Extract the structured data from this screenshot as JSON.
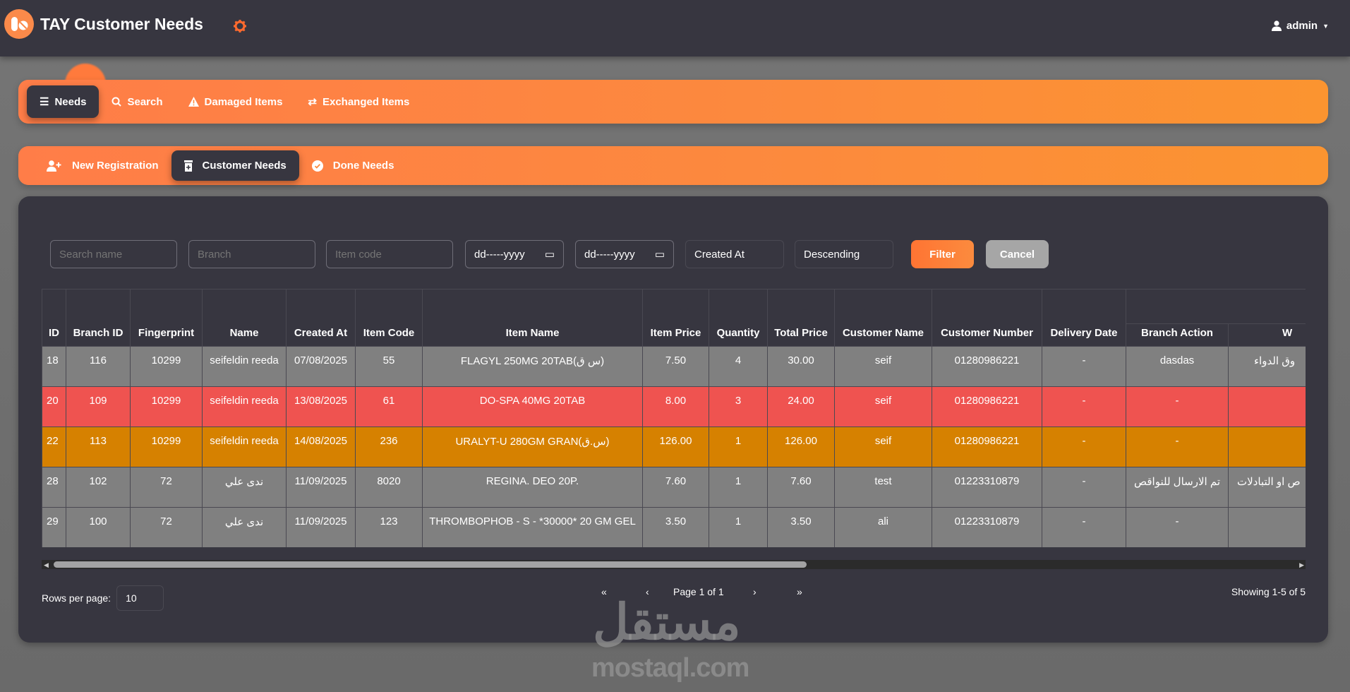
{
  "header": {
    "title": "TAY Customer Needs",
    "user": "admin",
    "icons": {
      "logo": "pills-icon",
      "settings": "gear-icon",
      "user": "user-icon",
      "caret": "caret-down-icon"
    },
    "accent": "#ff7d48"
  },
  "main_nav": [
    {
      "label": "Needs",
      "icon": "list-check-icon",
      "active": true
    },
    {
      "label": "Search",
      "icon": "search-icon",
      "active": false
    },
    {
      "label": "Damaged Items",
      "icon": "warning-icon",
      "active": false
    },
    {
      "label": "Exchanged Items",
      "icon": "exchange-icon",
      "active": false
    }
  ],
  "sub_nav": [
    {
      "label": "New Registration",
      "icon": "user-plus-icon",
      "active": false
    },
    {
      "label": "Customer Needs",
      "icon": "prescription-bottle-icon",
      "active": true
    },
    {
      "label": "Done Needs",
      "icon": "check-circle-icon",
      "active": false
    }
  ],
  "filters": {
    "search_name_placeholder": "Search name",
    "branch_placeholder": "Branch",
    "item_code_placeholder": "Item code",
    "date_from": "dd-----yyyy",
    "date_to": "dd-----yyyy",
    "sort_by": "Created At",
    "sort_order": "Descending",
    "filter_label": "Filter",
    "cancel_label": "Cancel"
  },
  "table": {
    "columns": [
      "ID",
      "Branch ID",
      "Fingerprint",
      "Name",
      "Created At",
      "Item Code",
      "Item Name",
      "Item Price",
      "Quantity",
      "Total Price",
      "Customer Name",
      "Customer Number",
      "Delivery Date",
      "Branch Action",
      "W"
    ],
    "rows": [
      {
        "row_color": "#808080",
        "cells": [
          "18",
          "116",
          "10299",
          "seifeldin reeda",
          "07/08/2025",
          "55",
          "FLAGYL 250MG 20TAB(س ق)",
          "7.50",
          "4",
          "30.00",
          "seif",
          "01280986221",
          "-",
          "dasdas",
          "وق الدواء"
        ]
      },
      {
        "row_color": "#ef5350",
        "cells": [
          "20",
          "109",
          "10299",
          "seifeldin reeda",
          "13/08/2025",
          "61",
          "DO-SPA 40MG 20TAB",
          "8.00",
          "3",
          "24.00",
          "seif",
          "01280986221",
          "-",
          "-",
          ""
        ]
      },
      {
        "row_color": "#d68100",
        "cells": [
          "22",
          "113",
          "10299",
          "seifeldin reeda",
          "14/08/2025",
          "236",
          "URALYT-U 280GM GRAN(س.ق)",
          "126.00",
          "1",
          "126.00",
          "seif",
          "01280986221",
          "-",
          "-",
          ""
        ]
      },
      {
        "row_color": "#808080",
        "cells": [
          "28",
          "102",
          "72",
          "ندى علي",
          "11/09/2025",
          "8020",
          "REGINA. DEO 20P.",
          "7.60",
          "1",
          "7.60",
          "test",
          "01223310879",
          "-",
          "تم الارسال للنواقص",
          "ص او التبادلات"
        ]
      },
      {
        "row_color": "#808080",
        "cells": [
          "29",
          "100",
          "72",
          "ندى علي",
          "11/09/2025",
          "123",
          "THROMBOPHOB - S - *30000* 20 GM GEL",
          "3.50",
          "1",
          "3.50",
          "ali",
          "01223310879",
          "-",
          "-",
          ""
        ]
      }
    ]
  },
  "footer": {
    "rows_per_page_label": "Rows per page:",
    "rows_per_page": "10",
    "first": "«",
    "prev": "‹",
    "page_info": "Page 1 of 1",
    "next": "›",
    "last": "»",
    "showing": "Showing 1-5 of 5"
  },
  "watermark": {
    "arabic": "مستقل",
    "latin": "mostaql.com"
  }
}
